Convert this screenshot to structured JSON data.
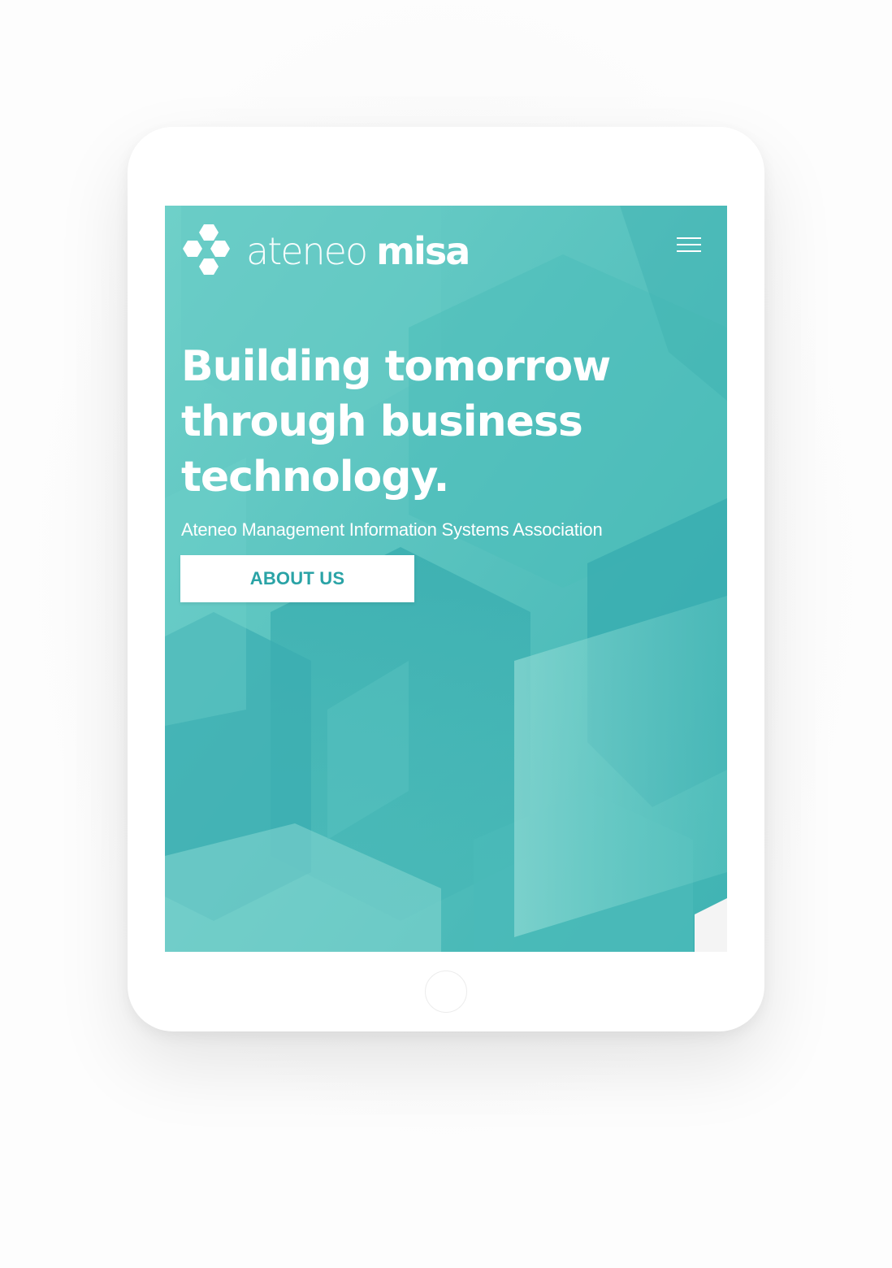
{
  "colors": {
    "accent": "#5cc6c2",
    "accent_dark": "#2aa3a6",
    "button_text": "#2aa3a6",
    "white": "#ffffff"
  },
  "header": {
    "logo_word_light": "ateneo",
    "logo_word_bold": "misa",
    "logo_icon": "hexagon-cluster-icon",
    "menu_icon": "hamburger-menu-icon"
  },
  "hero": {
    "title_lines": [
      "Building tomorrow",
      "through business",
      "technology."
    ],
    "subtitle": "Ateneo Management Information Systems Association",
    "cta_label": "ABOUT US"
  }
}
